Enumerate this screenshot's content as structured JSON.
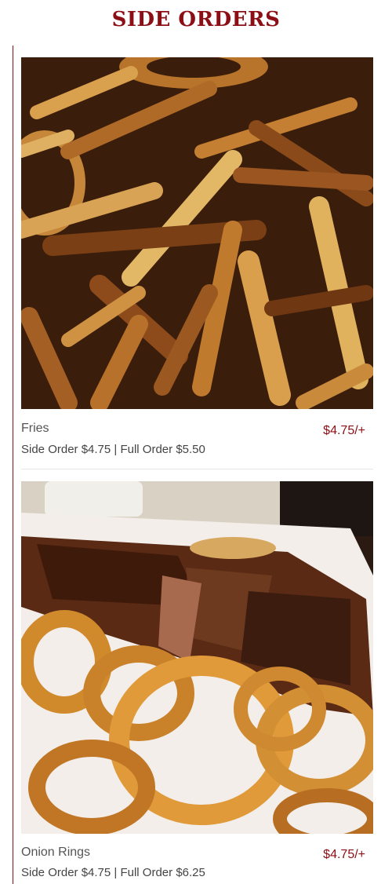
{
  "page": {
    "title": "SIDE ORDERS"
  },
  "items": [
    {
      "name": "Fries",
      "price": "$4.75/+",
      "detail": "Side Order $4.75 | Full Order $5.50",
      "image": "fries-photo"
    },
    {
      "name": "Onion Rings",
      "price": "$4.75/+",
      "detail": "Side Order $4.75 | Full Order $6.25",
      "image": "onion-rings-photo"
    }
  ],
  "colors": {
    "accent": "#8b0f14",
    "text": "#555555"
  }
}
